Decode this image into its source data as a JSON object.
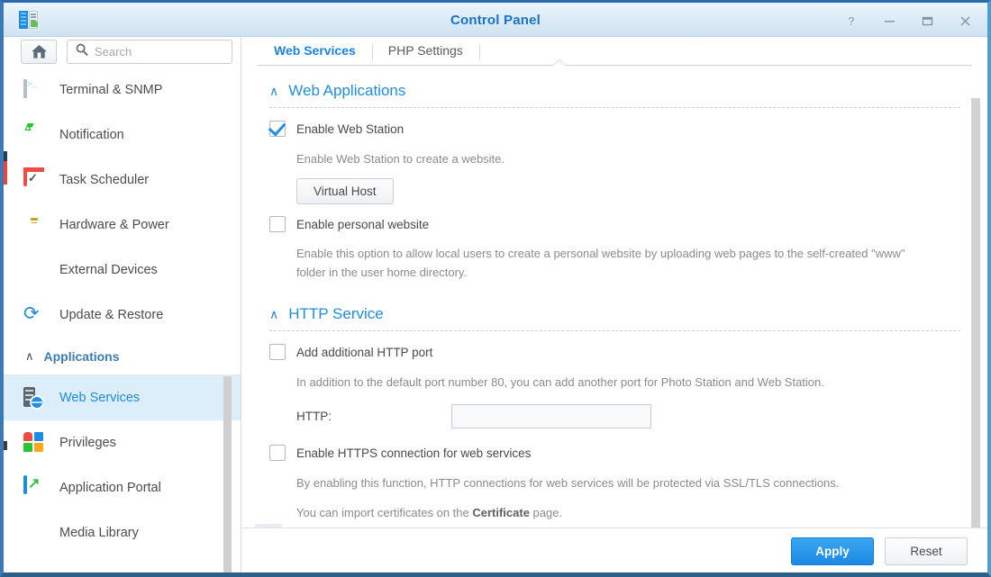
{
  "window": {
    "title": "Control Panel",
    "app_icon": "control-panel-icon",
    "controls": [
      {
        "name": "help-button",
        "glyph": "?"
      },
      {
        "name": "minimize-button",
        "glyph": "–"
      },
      {
        "name": "maximize-button",
        "glyph": "□"
      },
      {
        "name": "close-button",
        "glyph": "×"
      }
    ]
  },
  "sidebar": {
    "home_button_icon": "home-icon",
    "search": {
      "placeholder": "Search",
      "value": ""
    },
    "items": [
      {
        "label": "Terminal & SNMP",
        "icon": "terminal-icon",
        "selected": false
      },
      {
        "label": "Notification",
        "icon": "notification-icon",
        "selected": false
      },
      {
        "label": "Task Scheduler",
        "icon": "task-scheduler-icon",
        "selected": false
      },
      {
        "label": "Hardware & Power",
        "icon": "lightbulb-icon",
        "selected": false
      },
      {
        "label": "External Devices",
        "icon": "external-devices-icon",
        "selected": false
      },
      {
        "label": "Update & Restore",
        "icon": "update-restore-icon",
        "selected": false
      }
    ],
    "group": {
      "label": "Applications",
      "chevron": "∧",
      "expanded": true
    },
    "group_items": [
      {
        "label": "Web Services",
        "icon": "web-services-icon",
        "selected": true
      },
      {
        "label": "Privileges",
        "icon": "privileges-icon",
        "selected": false
      },
      {
        "label": "Application Portal",
        "icon": "application-portal-icon",
        "selected": false
      },
      {
        "label": "Media Library",
        "icon": "media-library-icon",
        "selected": false
      }
    ]
  },
  "main": {
    "tabs": [
      {
        "label": "Web Services",
        "active": true
      },
      {
        "label": "PHP Settings",
        "active": false
      }
    ],
    "sections": [
      {
        "title": "Web Applications",
        "chevron": "∧",
        "enable_web_station": {
          "label": "Enable Web Station",
          "checked": true,
          "description": "Enable Web Station to create a website.",
          "button": "Virtual Host"
        },
        "enable_personal_website": {
          "label": "Enable personal website",
          "checked": false,
          "description": "Enable this option to allow local users to create a personal website by uploading web pages to the self-created \"www\" folder in the user home directory."
        }
      },
      {
        "title": "HTTP Service",
        "chevron": "∧",
        "add_http_port": {
          "label": "Add additional HTTP port",
          "checked": false,
          "description": "In addition to the default port number 80, you can add another port for Photo Station and Web Station.",
          "field_label": "HTTP:",
          "field_value": "",
          "field_placeholder": ""
        },
        "enable_https": {
          "label": "Enable HTTPS connection for web services",
          "checked": false,
          "description": "By enabling this function, HTTP connections for web services will be protected via SSL/TLS connections.",
          "note_prefix": "You can import certificates on the ",
          "note_link": "Certificate",
          "note_suffix": " page."
        }
      }
    ]
  },
  "footer": {
    "apply_label": "Apply",
    "reset_label": "Reset"
  },
  "colors": {
    "accent": "#1e8ee0",
    "title": "#1673cc",
    "selected_row": "#ddeefb",
    "primary_button": "#1a8ae4"
  }
}
